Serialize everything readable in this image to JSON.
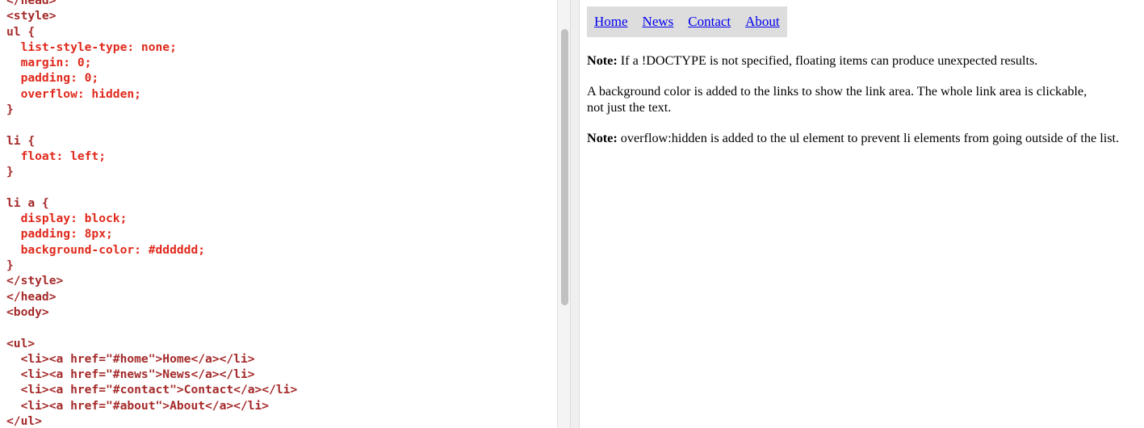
{
  "code_editor": {
    "lines": [
      "</head>",
      "<style>",
      "ul {",
      "  list-style-type: none;",
      "  margin: 0;",
      "  padding: 0;",
      "  overflow: hidden;",
      "}",
      "",
      "li {",
      "  float: left;",
      "}",
      "",
      "li a {",
      "  display: block;",
      "  padding: 8px;",
      "  background-color: #dddddd;",
      "}",
      "</style>",
      "</head>",
      "<body>",
      "",
      "<ul>",
      "  <li><a href=\"#home\">Home</a></li>",
      "  <li><a href=\"#news\">News</a></li>",
      "  <li><a href=\"#contact\">Contact</a></li>",
      "  <li><a href=\"#about\">About</a></li>",
      "</ul>"
    ]
  },
  "preview": {
    "nav": [
      {
        "label": "Home"
      },
      {
        "label": "News"
      },
      {
        "label": "Contact"
      },
      {
        "label": "About"
      }
    ],
    "note1_strong": "Note:",
    "note1_text": " If a !DOCTYPE is not specified, floating items can produce unexpected results.",
    "para2": "A background color is added to the links to show the link area. The whole link area is clickable, not just the text.",
    "note3_strong": "Note:",
    "note3_text": " overflow:hidden is added to the ul element to prevent li elements from going outside of the list."
  },
  "colors": {
    "tag": "#a52a2a",
    "property": "#e0291c",
    "value": "#1a1aa6",
    "link": "#0000ee",
    "nav_background": "#dddddd"
  }
}
